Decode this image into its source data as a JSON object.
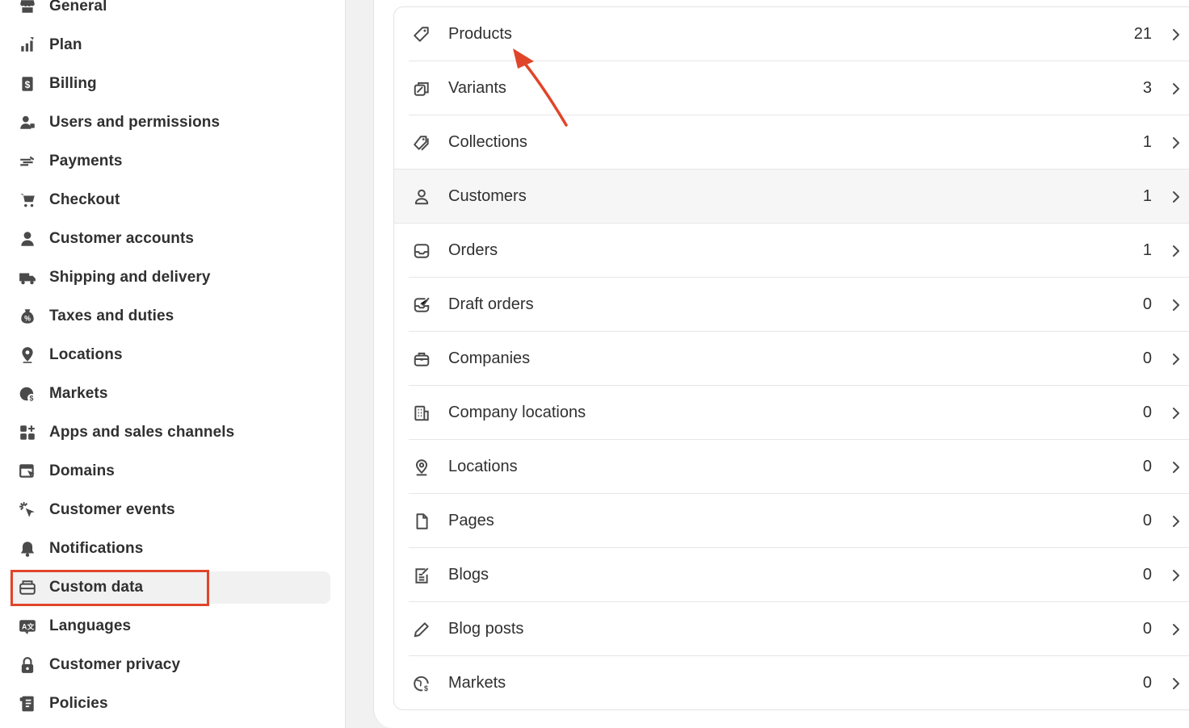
{
  "sidebar": {
    "items": [
      {
        "label": "General",
        "icon": "store-icon"
      },
      {
        "label": "Plan",
        "icon": "plan-icon"
      },
      {
        "label": "Billing",
        "icon": "billing-icon"
      },
      {
        "label": "Users and permissions",
        "icon": "users-icon"
      },
      {
        "label": "Payments",
        "icon": "payments-icon"
      },
      {
        "label": "Checkout",
        "icon": "cart-icon"
      },
      {
        "label": "Customer accounts",
        "icon": "person-icon"
      },
      {
        "label": "Shipping and delivery",
        "icon": "truck-icon"
      },
      {
        "label": "Taxes and duties",
        "icon": "tax-icon"
      },
      {
        "label": "Locations",
        "icon": "location-pin-icon"
      },
      {
        "label": "Markets",
        "icon": "globe-icon"
      },
      {
        "label": "Apps and sales channels",
        "icon": "apps-icon"
      },
      {
        "label": "Domains",
        "icon": "domains-icon"
      },
      {
        "label": "Customer events",
        "icon": "cursor-click-icon"
      },
      {
        "label": "Notifications",
        "icon": "bell-icon"
      },
      {
        "label": "Custom data",
        "icon": "custom-data-icon",
        "active": true
      },
      {
        "label": "Languages",
        "icon": "translate-icon"
      },
      {
        "label": "Customer privacy",
        "icon": "lock-icon"
      },
      {
        "label": "Policies",
        "icon": "policy-icon"
      }
    ]
  },
  "metafields": {
    "rows": [
      {
        "label": "Products",
        "count": "21",
        "icon": "tag-icon"
      },
      {
        "label": "Variants",
        "count": "3",
        "icon": "variants-icon"
      },
      {
        "label": "Collections",
        "count": "1",
        "icon": "collections-icon"
      },
      {
        "label": "Customers",
        "count": "1",
        "icon": "customer-icon"
      },
      {
        "label": "Orders",
        "count": "1",
        "icon": "inbox-icon"
      },
      {
        "label": "Draft orders",
        "count": "0",
        "icon": "draft-order-icon"
      },
      {
        "label": "Companies",
        "count": "0",
        "icon": "briefcase-icon"
      },
      {
        "label": "Company locations",
        "count": "0",
        "icon": "building-icon"
      },
      {
        "label": "Locations",
        "count": "0",
        "icon": "location-pin-icon"
      },
      {
        "label": "Pages",
        "count": "0",
        "icon": "page-icon"
      },
      {
        "label": "Blogs",
        "count": "0",
        "icon": "blog-icon"
      },
      {
        "label": "Blog posts",
        "count": "0",
        "icon": "pencil-icon"
      },
      {
        "label": "Markets",
        "count": "0",
        "icon": "globe-icon"
      }
    ]
  },
  "colors": {
    "annotation": "#e0452a",
    "active_bg": "#f1f1f1",
    "hover_bg": "#f6f6f6"
  }
}
